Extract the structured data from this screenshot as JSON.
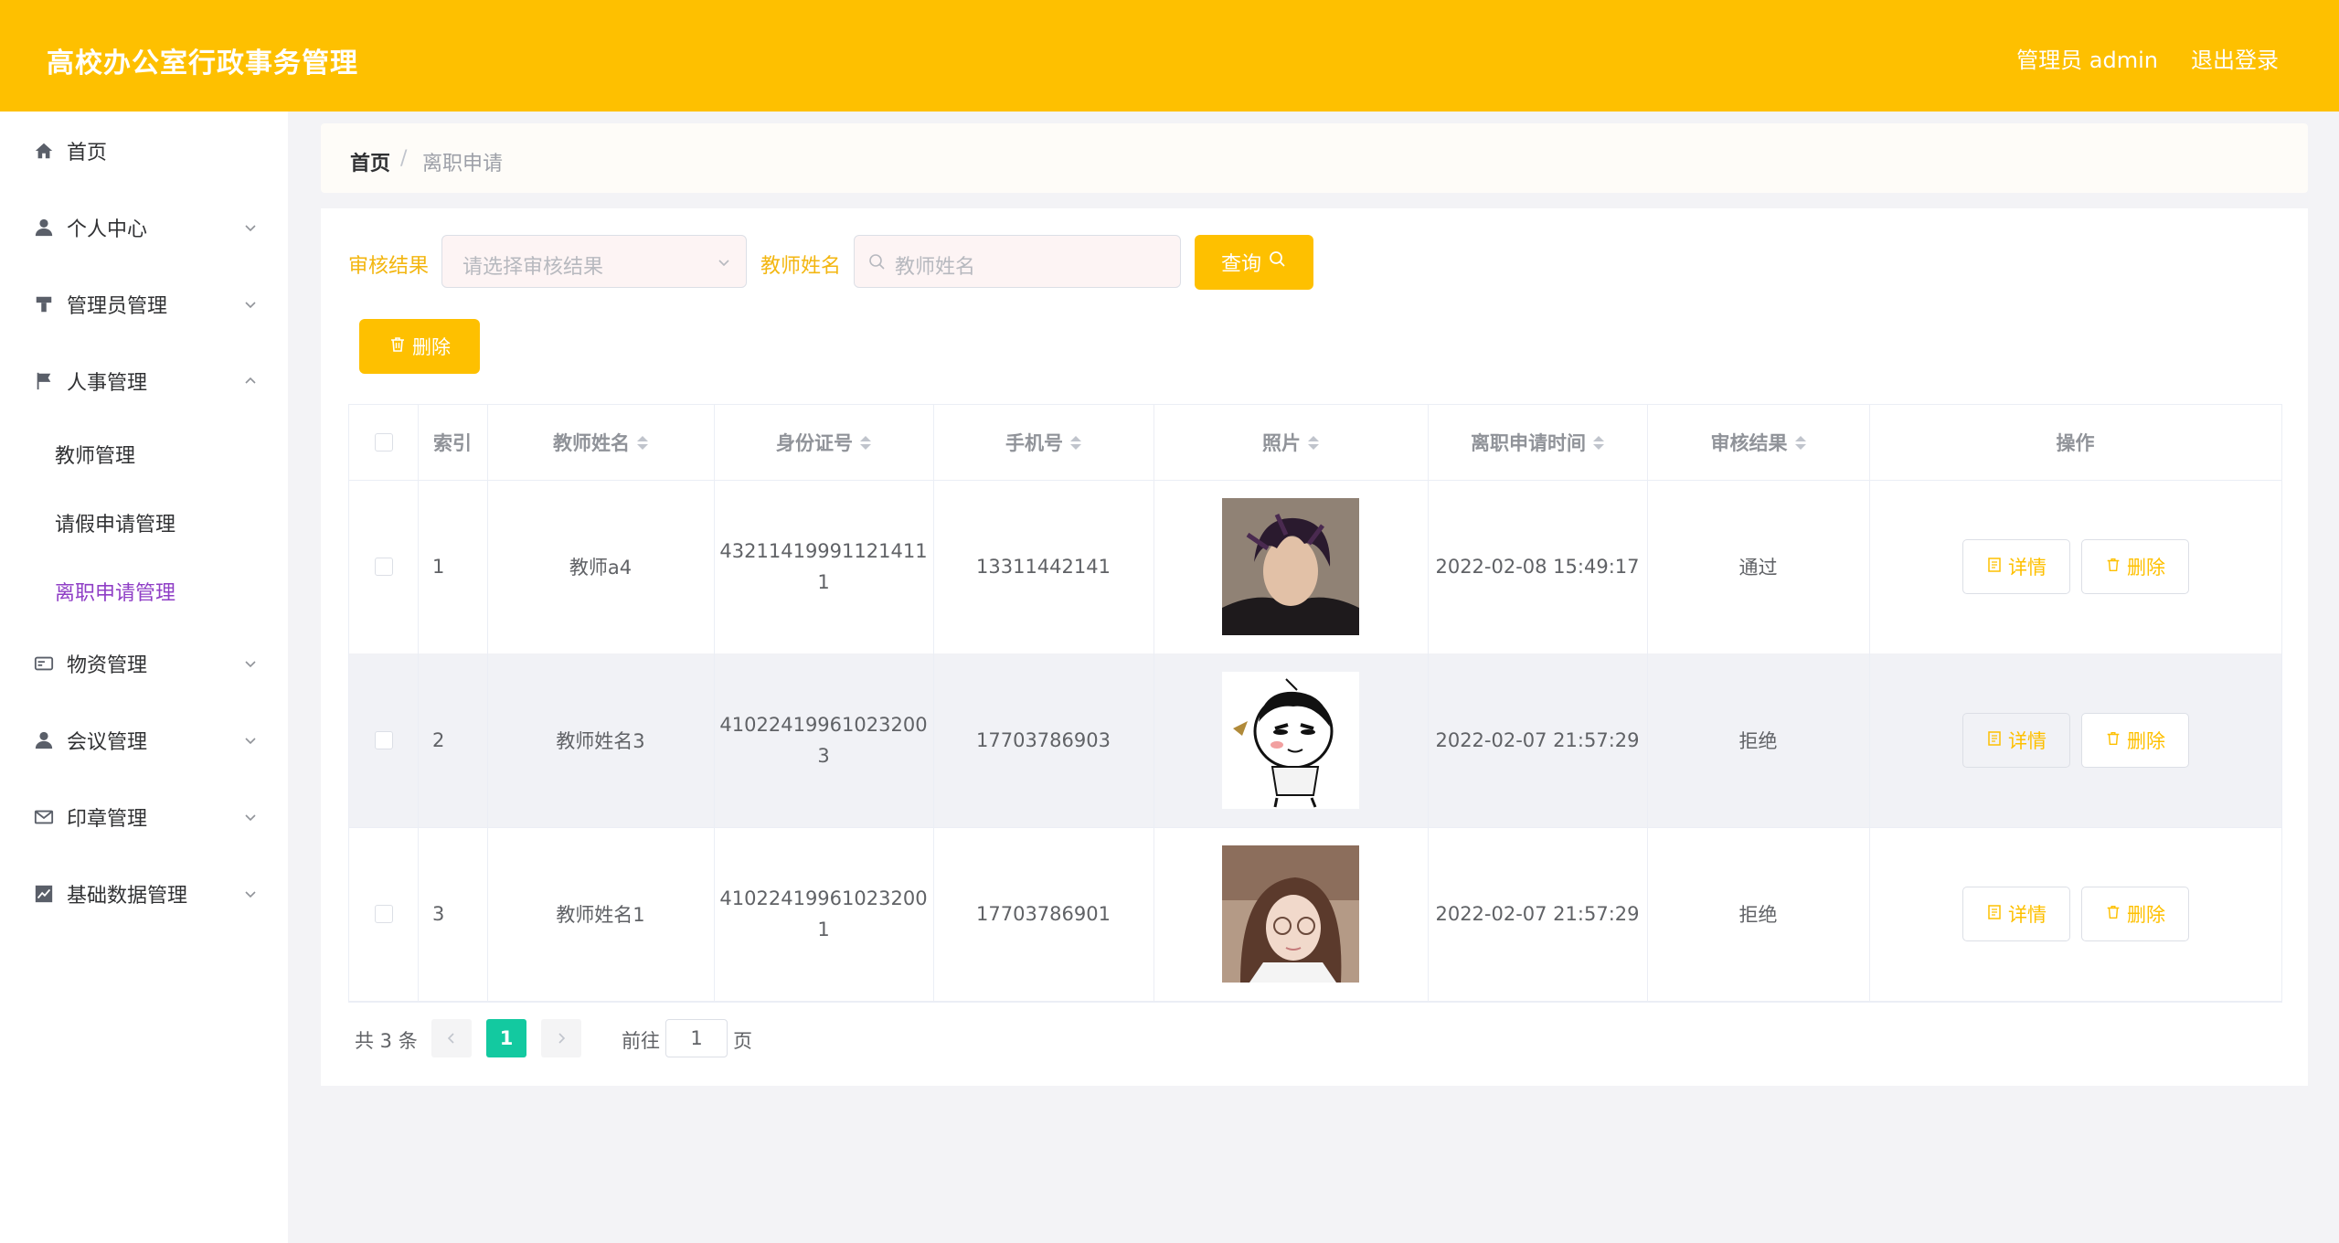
{
  "header": {
    "title": "高校办公室行政事务管理",
    "user": "管理员 admin",
    "logout": "退出登录"
  },
  "sidebar": {
    "items": [
      {
        "label": "首页",
        "icon": "home-icon"
      },
      {
        "label": "个人中心",
        "icon": "user-icon"
      },
      {
        "label": "管理员管理",
        "icon": "stamp-icon"
      },
      {
        "label": "人事管理",
        "icon": "flag-icon"
      },
      {
        "label": "物资管理",
        "icon": "card-icon"
      },
      {
        "label": "会议管理",
        "icon": "user-icon"
      },
      {
        "label": "印章管理",
        "icon": "mail-icon"
      },
      {
        "label": "基础数据管理",
        "icon": "chart-icon"
      }
    ],
    "sub_items": [
      "教师管理",
      "请假申请管理",
      "离职申请管理"
    ]
  },
  "breadcrumb": {
    "home": "首页",
    "separator": "/",
    "current": "离职申请"
  },
  "filters": {
    "result_label": "审核结果",
    "result_placeholder": "请选择审核结果",
    "name_label": "教师姓名",
    "name_placeholder": "教师姓名",
    "query": "查询"
  },
  "actions": {
    "delete": "删除"
  },
  "table": {
    "headers": [
      "索引",
      "教师姓名",
      "身份证号",
      "手机号",
      "照片",
      "离职申请时间",
      "审核结果",
      "操作"
    ],
    "rows": [
      {
        "index": "1",
        "name": "教师a4",
        "id_line1": "43211419991121411",
        "id_line2": "1",
        "phone": "13311442141",
        "time": "2022-02-08 15:49:17",
        "result": "通过"
      },
      {
        "index": "2",
        "name": "教师姓名3",
        "id_line1": "41022419961023200",
        "id_line2": "3",
        "phone": "17703786903",
        "time": "2022-02-07 21:57:29",
        "result": "拒绝"
      },
      {
        "index": "3",
        "name": "教师姓名1",
        "id_line1": "41022419961023200",
        "id_line2": "1",
        "phone": "17703786901",
        "time": "2022-02-07 21:57:29",
        "result": "拒绝"
      }
    ],
    "detail_btn": "详情",
    "delete_btn": "删除"
  },
  "pagination": {
    "total": "共 3 条",
    "current": "1",
    "goto_label": "前往",
    "goto_value": "1",
    "goto_suffix": "页"
  },
  "colors": {
    "accent": "#fec000",
    "active_menu": "#8f3ec6",
    "pager_active": "#13c9a0"
  }
}
